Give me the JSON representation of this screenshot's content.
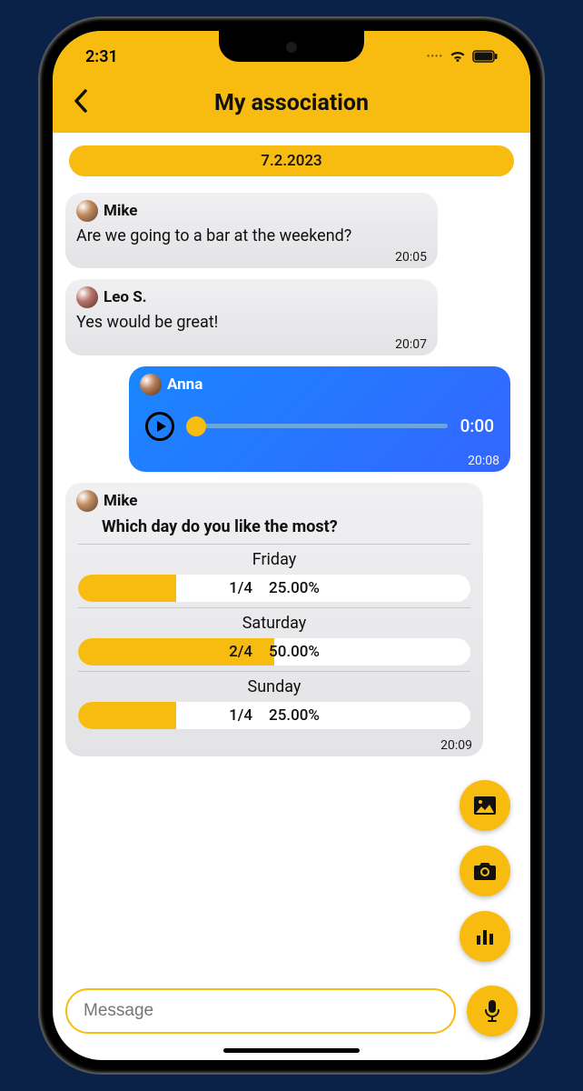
{
  "status": {
    "time": "2:31"
  },
  "header": {
    "title": "My association"
  },
  "date_separator": "7.2.2023",
  "messages": [
    {
      "sender": "Mike",
      "text": "Are we going to a bar at the weekend?",
      "time": "20:05"
    },
    {
      "sender": "Leo S.",
      "text": "Yes would be great!",
      "time": "20:07"
    }
  ],
  "audio": {
    "sender": "Anna",
    "position": "0:00",
    "time": "20:08"
  },
  "poll": {
    "sender": "Mike",
    "question": "Which day do you like the most?",
    "options": [
      {
        "day": "Friday",
        "votes": "1/4",
        "percent": "25.00%",
        "fill": 25
      },
      {
        "day": "Saturday",
        "votes": "2/4",
        "percent": "50.00%",
        "fill": 50
      },
      {
        "day": "Sunday",
        "votes": "1/4",
        "percent": "25.00%",
        "fill": 25
      }
    ],
    "time": "20:09"
  },
  "composer": {
    "placeholder": "Message"
  }
}
